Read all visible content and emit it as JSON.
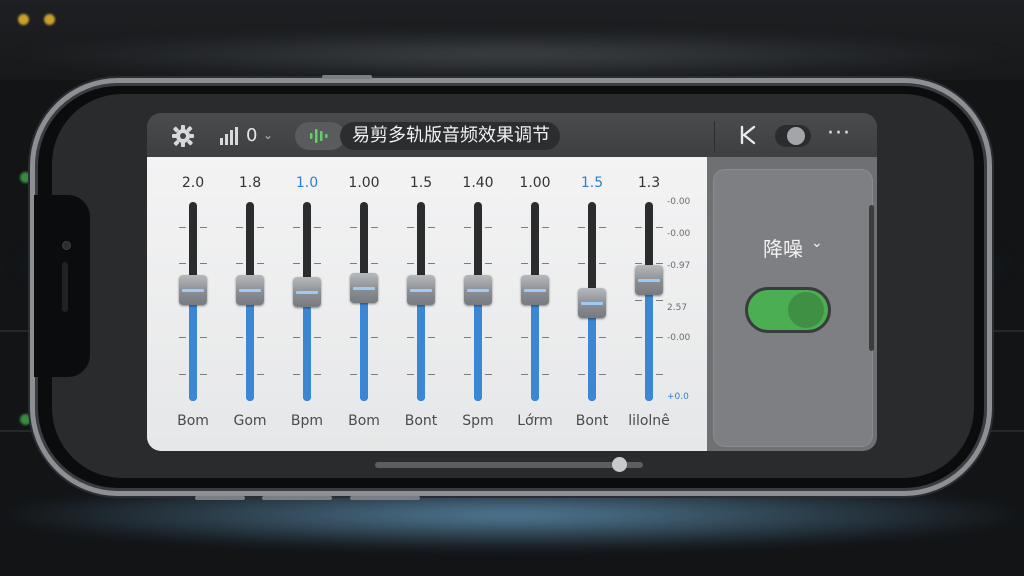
{
  "background": {
    "wave_color": "#5f96be",
    "accent_dots": "#c9a12c"
  },
  "toolbar": {
    "settings_icon": "gear-icon",
    "level_icon": "signal-bars-icon",
    "level_value": "0",
    "level_chevron": "⌄",
    "waveform_icon": "waveform-icon",
    "title": "易剪多轨版音频效果调节",
    "back_icon": "k-back-icon",
    "toggle_state": "off",
    "more_label": "···"
  },
  "equalizer": {
    "track_fill_color": "#3c87d4",
    "bands": [
      {
        "value": "2.0",
        "label": "Bom",
        "highlight": false,
        "level": 0.56
      },
      {
        "value": "1.8",
        "label": "Gom",
        "highlight": false,
        "level": 0.56
      },
      {
        "value": "1.0",
        "label": "Bpm",
        "highlight": true,
        "level": 0.55
      },
      {
        "value": "1.00",
        "label": "Bom",
        "highlight": false,
        "level": 0.57
      },
      {
        "value": "1.5",
        "label": "Bont",
        "highlight": false,
        "level": 0.56
      },
      {
        "value": "1.40",
        "label": "Spm",
        "highlight": false,
        "level": 0.56
      },
      {
        "value": "1.00",
        "label": "Lớrm",
        "highlight": false,
        "level": 0.56
      },
      {
        "value": "1.5",
        "label": "Bont",
        "highlight": true,
        "level": 0.49
      },
      {
        "value": "1.3",
        "label": "lilolnê",
        "highlight": false,
        "level": 0.61
      }
    ],
    "scale": [
      "-0.00",
      "-0.00",
      "-0.97",
      "2.57",
      "-0.00",
      "+0.0"
    ]
  },
  "noise_panel": {
    "label": "降噪",
    "chevron": "⌄",
    "toggle_state": "on",
    "toggle_color": "#4cae52"
  }
}
